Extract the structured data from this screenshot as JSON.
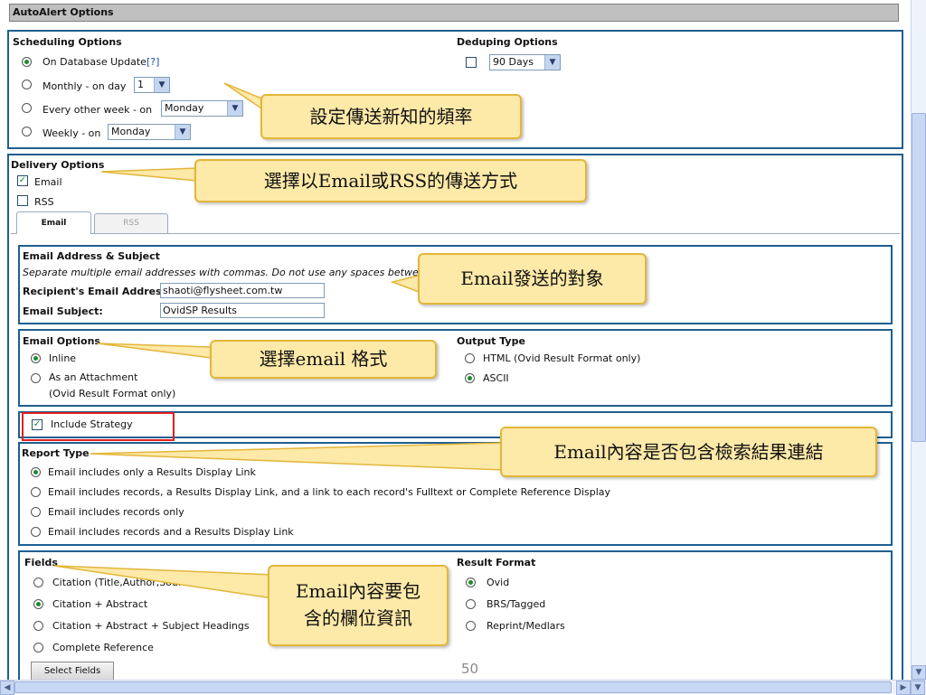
{
  "page_title": "AutoAlert Options",
  "scheduling": {
    "title": "Scheduling Options",
    "on_db_update": "On Database Update",
    "help": "[?]",
    "monthly": "Monthly - on day",
    "monthly_value": "1",
    "every_other_week": "Every other week - on",
    "every_other_week_value": "Monday",
    "weekly": "Weekly - on",
    "weekly_value": "Monday"
  },
  "deduping": {
    "title": "Deduping Options",
    "value": "90 Days"
  },
  "delivery": {
    "title": "Delivery Options",
    "email": "Email",
    "rss": "RSS",
    "tab_email": "Email",
    "tab_rss": "RSS"
  },
  "address": {
    "title": "Email Address & Subject",
    "note": "Separate multiple email addresses with commas. Do not use any spaces betwee",
    "recipient_label": "Recipient's Email Address:",
    "recipient_value": "shaoti@flysheet.com.tw",
    "subject_label": "Email Subject:",
    "subject_value": "OvidSP Results"
  },
  "email_options": {
    "title": "Email Options",
    "inline": "Inline",
    "attachment": "As an Attachment",
    "attachment_note": "(Ovid Result Format only)"
  },
  "output_type": {
    "title": "Output Type",
    "html": "HTML (Ovid Result Format only)",
    "ascii": "ASCII"
  },
  "include_strategy": "Include Strategy",
  "report_type": {
    "title": "Report Type",
    "options": [
      "Email includes only a Results Display Link",
      "Email includes records, a Results Display Link, and a link to each record's Fulltext or Complete Reference Display",
      "Email includes records only",
      "Email includes records and a Results Display Link"
    ]
  },
  "fields": {
    "title": "Fields",
    "options": [
      "Citation (Title,Author,Source)",
      "Citation + Abstract",
      "Citation + Abstract + Subject Headings",
      "Complete Reference"
    ],
    "select_button": "Select Fields"
  },
  "result_format": {
    "title": "Result Format",
    "options": [
      "Ovid",
      "BRS/Tagged",
      "Reprint/Medlars"
    ]
  },
  "callouts": {
    "c1": "設定傳送新知的頻率",
    "c2": "選擇以Email或RSS的傳送方式",
    "c3": "Email發送的對象",
    "c4": "選擇email 格式",
    "c5": "Email內容是否包含檢索結果連結",
    "c6_line1": "Email內容要包",
    "c6_line2": "含的欄位資訊"
  },
  "page_number": "50",
  "colors": {
    "frame": "#1f5f8f",
    "callout_fill": "#fde9a8",
    "callout_border": "#e2b63a",
    "highlight": "#e02020"
  }
}
